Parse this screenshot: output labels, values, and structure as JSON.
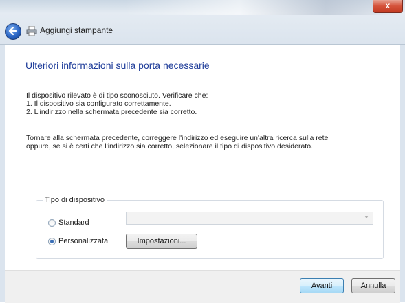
{
  "window": {
    "title": "Aggiungi stampante",
    "close_glyph": "x"
  },
  "main": {
    "heading": "Ulteriori informazioni sulla porta necessarie",
    "paragraph1": [
      "Il dispositivo rilevato è di tipo sconosciuto. Verificare che:",
      "1. Il dispositivo sia configurato correttamente.",
      "2. L'indirizzo nella schermata precedente sia corretto."
    ],
    "paragraph2": [
      "Tornare alla schermata precedente, correggere l'indirizzo ed eseguire un'altra ricerca sulla rete",
      "oppure, se si è certi che l'indirizzo sia corretto, selezionare il tipo di dispositivo desiderato."
    ]
  },
  "device_type": {
    "legend": "Tipo di dispositivo",
    "standard_label": "Standard",
    "custom_label": "Personalizzata",
    "selected": "Personalizzata",
    "standard_combo_value": "",
    "settings_button": "Impostazioni..."
  },
  "footer": {
    "next_button": "Avanti",
    "cancel_button": "Annulla"
  },
  "icons": {
    "back": "back-arrow-icon",
    "printer": "printer-icon",
    "close": "close-icon"
  }
}
